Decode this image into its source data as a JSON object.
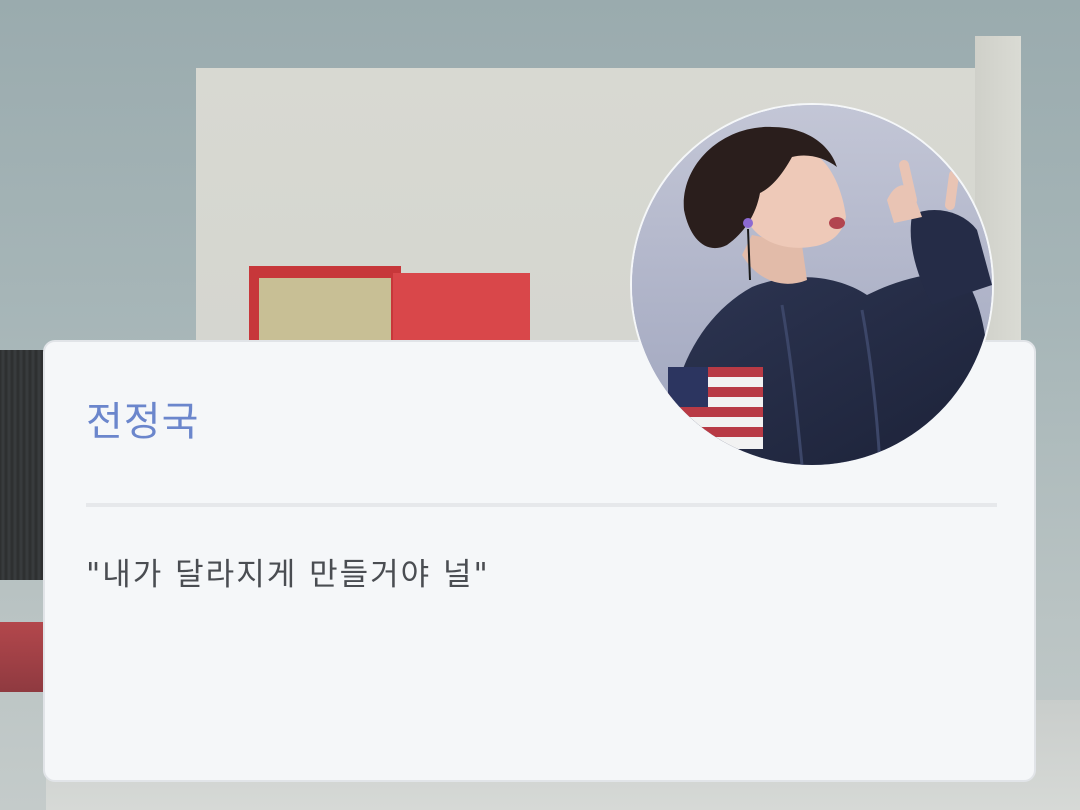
{
  "profile": {
    "name": "전정국",
    "quote": "\"내가 달라지게 만들거야 널\""
  },
  "colors": {
    "name_accent": "#6b86cc",
    "card_background": "#f5f7f9",
    "quote_text": "#4a4d52"
  },
  "icons": {
    "avatar": "profile-photo"
  }
}
